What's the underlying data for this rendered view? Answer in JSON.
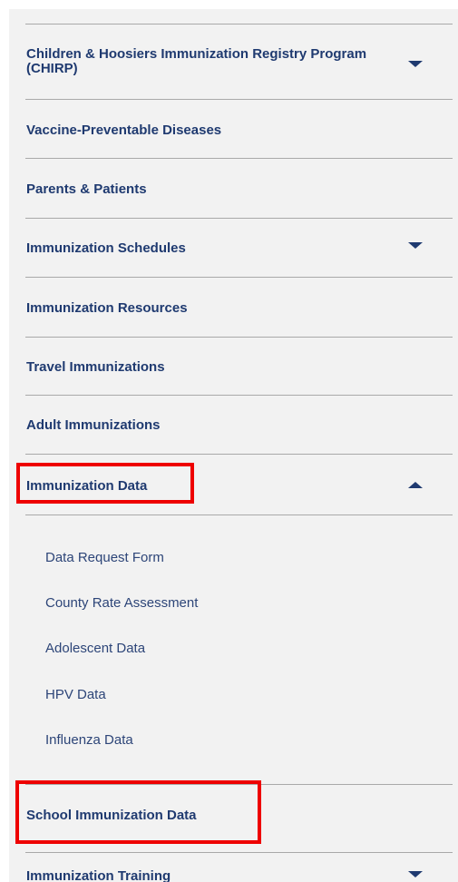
{
  "nav": {
    "chirp": "Children & Hoosiers Immunization Registry Program (CHIRP)",
    "vaccine_preventable": "Vaccine-Preventable Diseases",
    "parents_patients": "Parents & Patients",
    "schedules": "Immunization Schedules",
    "resources": "Immunization Resources",
    "travel": "Travel Immunizations",
    "adult": "Adult Immunizations",
    "data": "Immunization Data",
    "school_data": "School Immunization Data",
    "training": "Immunization Training"
  },
  "submenu": {
    "items": [
      "Data Request Form",
      "County Rate Assessment",
      "Adolescent Data",
      "HPV Data",
      "Influenza Data"
    ]
  },
  "colors": {
    "panel_background": "#f2f2f2",
    "link": "#1f3a70",
    "highlight": "#ee0000"
  },
  "icons": {
    "expand": "caret-down-icon",
    "collapse": "caret-up-icon"
  }
}
